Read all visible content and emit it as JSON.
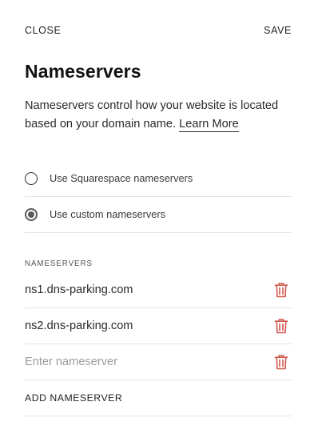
{
  "header": {
    "close_label": "CLOSE",
    "save_label": "SAVE"
  },
  "page": {
    "title": "Nameservers",
    "description": "Nameservers control how your website is located based on your domain name.",
    "learn_more_label": "Learn More"
  },
  "options": [
    {
      "label": "Use Squarespace nameservers",
      "selected": false
    },
    {
      "label": "Use custom nameservers",
      "selected": true
    }
  ],
  "nameservers": {
    "section_label": "NAMESERVERS",
    "entries": [
      {
        "value": "ns1.dns-parking.com"
      },
      {
        "value": "ns2.dns-parking.com"
      }
    ],
    "new_entry_placeholder": "Enter nameserver",
    "add_label": "ADD NAMESERVER"
  },
  "icons": {
    "delete": "trash-icon",
    "radio_selected": "radio-checked-icon",
    "radio_unselected": "radio-unchecked-icon"
  },
  "colors": {
    "delete_icon": "#d0574f",
    "divider": "#e3e3e3",
    "text": "#1f1f1f",
    "placeholder": "#9c9c9c"
  }
}
